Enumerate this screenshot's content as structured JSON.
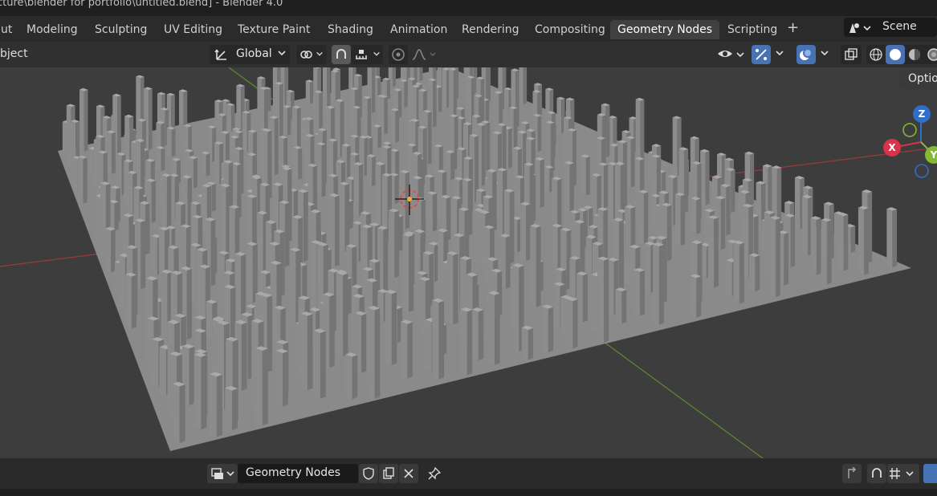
{
  "window": {
    "title": "cture\\blender for portfolio\\untitled.blend] - Blender 4.0"
  },
  "workspace_tabs": [
    {
      "label": "ut"
    },
    {
      "label": "Modeling"
    },
    {
      "label": "Sculpting"
    },
    {
      "label": "UV Editing"
    },
    {
      "label": "Texture Paint"
    },
    {
      "label": "Shading"
    },
    {
      "label": "Animation"
    },
    {
      "label": "Rendering"
    },
    {
      "label": "Compositing"
    },
    {
      "label": "Geometry Nodes",
      "active": true
    },
    {
      "label": "Scripting"
    }
  ],
  "scene": {
    "label": "Scene"
  },
  "header": {
    "mode_label": "bject",
    "orientation": "Global"
  },
  "viewport": {
    "options_label": "Option",
    "gizmo": {
      "z": "Z",
      "x": "X",
      "y": "Y"
    }
  },
  "footer": {
    "node_group": "Geometry Nodes"
  },
  "colors": {
    "accent": "#4772b3",
    "active_tab": "#404040",
    "axis_x": "#d7344a",
    "axis_y": "#84b935",
    "axis_z": "#2e6fc9"
  }
}
